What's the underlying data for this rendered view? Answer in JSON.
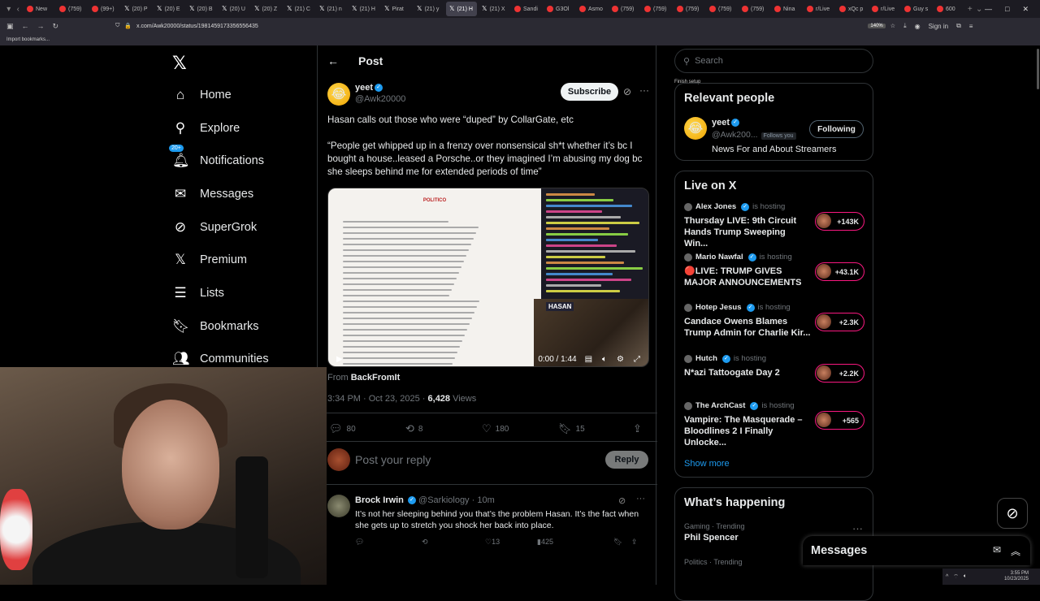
{
  "browser": {
    "tabs": [
      "New",
      "(759)",
      "(99+)",
      "(20) P",
      "(20) E",
      "(20) B",
      "(20) U",
      "(20) Z",
      "(21) C",
      "(21) n",
      "(21) H",
      "Pirat",
      "(21) y",
      "(21) H",
      "(21) X",
      "Sandi",
      "G3Ol",
      "Asmo",
      "(759)",
      "(759)",
      "(759)",
      "(759)",
      "(759)",
      "Nina",
      "r/Live",
      "xQc p",
      "r/Live",
      "Guy s",
      "600"
    ],
    "active_tab": "(21)",
    "url": "x.com/Awk20000/status/1981459173356556435",
    "zoom": "140%",
    "sign_in": "Sign in",
    "bookmarks_import": "Import bookmarks...",
    "finish_setup": "Finish setup"
  },
  "nav": {
    "home": "Home",
    "explore": "Explore",
    "notifications": "Notifications",
    "notif_badge": "20+",
    "messages": "Messages",
    "supergrok": "SuperGrok",
    "premium": "Premium",
    "lists": "Lists",
    "bookmarks": "Bookmarks",
    "communities": "Communities"
  },
  "post": {
    "header_title": "Post",
    "author_name": "yeet",
    "author_handle": "@Awk20000",
    "subscribe_label": "Subscribe",
    "text": "Hasan calls out those who were “duped” by CollarGate, etc\n\n“People get whipped up in a frenzy over nonsensical sh*t whether it’s bc I bought a house..leased a Porsche..or they imagined I’m abusing my dog bc she sleeps behind me for extended periods of time”",
    "video_time": "0:00 / 1:44",
    "video_masthead": "POLITICO",
    "video_cam_label": "HASAN",
    "from_prefix": "From",
    "from_source": "BackFromIt",
    "time_date": "3:34 PM · Oct 23, 2025 · ",
    "views_count": "6,428",
    "views_label": " Views",
    "replies": "80",
    "reposts": "8",
    "likes": "180",
    "bookmarks": "15",
    "reply_placeholder": "Post your reply",
    "reply_button": "Reply"
  },
  "reply": {
    "name": "Brock Irwin",
    "handle": "@Sarkiology",
    "age": "· 10m",
    "text": "It’s not her sleeping behind you that’s the problem Hasan. It’s the fact when she gets up to stretch you shock her back into place.",
    "likes": "13",
    "views": "425"
  },
  "sidebar": {
    "search_placeholder": "Search",
    "relevant_title": "Relevant people",
    "rp_name": "yeet",
    "rp_handle": "@Awk200...",
    "rp_follows_you": "Follows you",
    "rp_follow_btn": "Following",
    "rp_bio": "News For and About Streamers",
    "live_title": "Live on X",
    "is_hosting": "is hosting",
    "live": [
      {
        "host": "Alex Jones",
        "title": "Thursday LIVE: 9th Circuit Hands Trump Sweeping Win...",
        "count": "+143K"
      },
      {
        "host": "Mario Nawfal",
        "title": "🔴LIVE: TRUMP GIVES MAJOR ANNOUNCEMENTS",
        "count": "+43.1K"
      },
      {
        "host": "Hotep Jesus",
        "title": "Candace Owens Blames Trump Admin for Charlie Kir...",
        "count": "+2.3K"
      },
      {
        "host": "Hutch",
        "title": "N*azi Tattoogate Day 2",
        "count": "+2.2K"
      },
      {
        "host": "The ArchCast",
        "title": "Vampire: The Masquerade – Bloodlines 2 I Finally Unlocke...",
        "count": "+565"
      }
    ],
    "show_more": "Show more",
    "happening_title": "What’s happening",
    "trend1_sub": "Gaming · Trending",
    "trend1_title": "Phil Spencer",
    "trend2_sub": "Politics · Trending"
  },
  "messages_dock": {
    "label": "Messages"
  },
  "taskbar": {
    "time": "3:55 PM",
    "date": "10/23/2025"
  },
  "colors": {
    "accent": "#1d9bf0",
    "live_ring": "#f91880",
    "bg": "#000000"
  }
}
